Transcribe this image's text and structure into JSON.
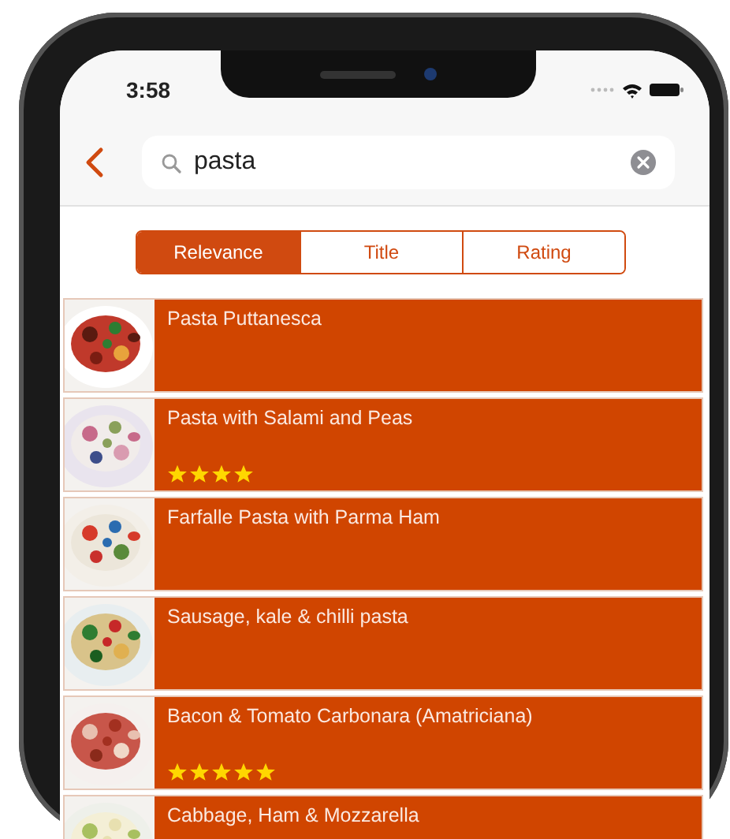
{
  "status_bar": {
    "time": "3:58"
  },
  "search": {
    "value": "pasta"
  },
  "sort_tabs": [
    {
      "label": "Relevance",
      "selected": true
    },
    {
      "label": "Title",
      "selected": false
    },
    {
      "label": "Rating",
      "selected": false
    }
  ],
  "recipes": [
    {
      "title": "Pasta Puttanesca"
    },
    {
      "title": "Pasta with Salami and Peas",
      "stars": 4
    },
    {
      "title": "Farfalle Pasta with Parma Ham"
    },
    {
      "title": "Sausage, kale & chilli pasta"
    },
    {
      "title": "Bacon & Tomato Carbonara (Amatriciana)",
      "stars": 5
    },
    {
      "title": "Cabbage, Ham & Mozzarella"
    }
  ]
}
